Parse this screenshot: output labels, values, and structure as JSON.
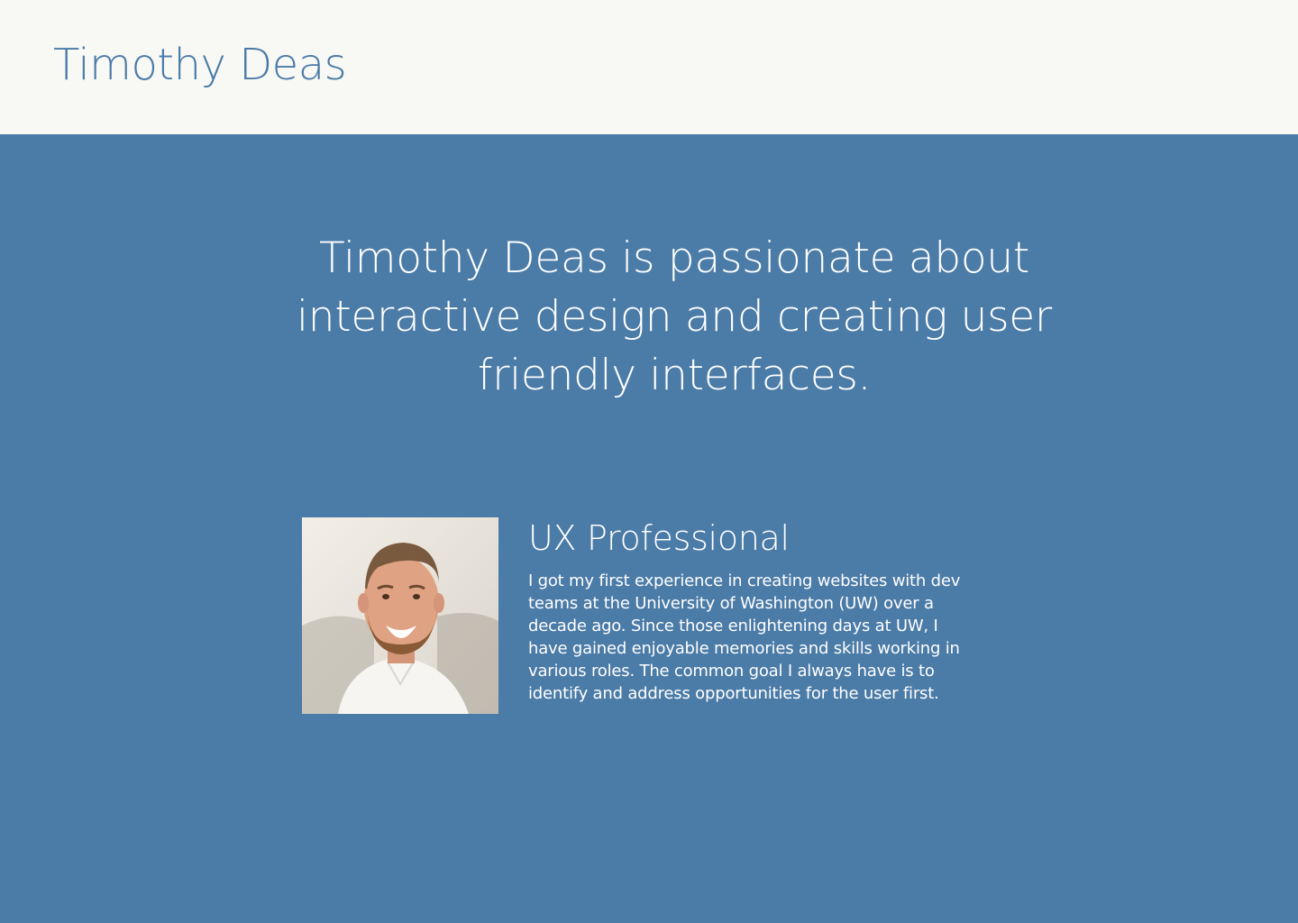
{
  "header": {
    "site_title": "Timothy Deas"
  },
  "hero": {
    "tagline": "Timothy Deas is passionate about interactive design and creating user friendly interfaces."
  },
  "profile": {
    "photo_alt": "Portrait of Timothy Deas",
    "role_title": "UX Professional",
    "bio": "I got my first experience in creating websites with dev teams at the University of Washington (UW) over a decade ago. Since those enlightening days at UW, I have gained enjoyable memories and skills working in various roles. The common goal I always have is to identify and address opportunities for the user first."
  },
  "colors": {
    "header_bg": "#f8f8f4",
    "title_color": "#4a7aa8",
    "main_bg": "#4b7ba7",
    "text_light": "#ffffff"
  }
}
